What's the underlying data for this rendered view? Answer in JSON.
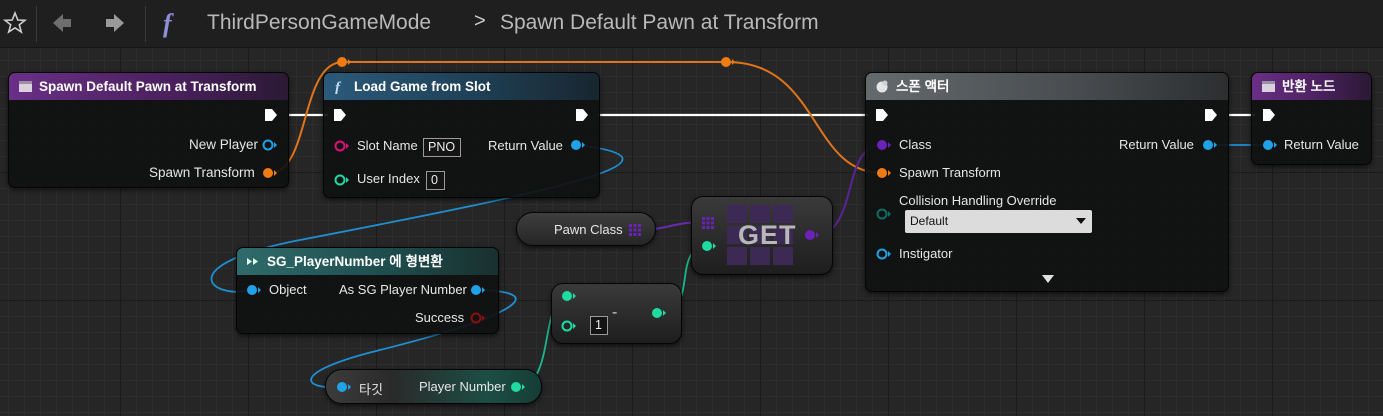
{
  "breadcrumb": {
    "blueprint": "ThirdPersonGameMode",
    "separator": ">",
    "graph": "Spawn Default Pawn at Transform"
  },
  "icons": {
    "favorite": "star-icon",
    "back": "back-arrow-icon",
    "forward": "forward-arrow-icon",
    "function": "function-icon"
  },
  "colors": {
    "exec": "#ffffff",
    "object_pin": "#1fa2e8",
    "transform_pin": "#f07b13",
    "class_pin": "#6b22b8",
    "string_pin": "#e0107b",
    "int_pin": "#1fdba0",
    "bool_pin": "#8c0f0f"
  },
  "nodes": {
    "entry": {
      "title": "Spawn Default Pawn at Transform",
      "pin_new_player": "New Player",
      "pin_spawn_transform": "Spawn Transform"
    },
    "load_game": {
      "title": "Load Game from Slot",
      "pin_slot_name": "Slot Name",
      "slot_name_value": "PNO",
      "pin_user_index": "User Index",
      "user_index_value": "0",
      "pin_return": "Return Value"
    },
    "cast": {
      "title": "SG_PlayerNumber 에 형변환",
      "pin_object": "Object",
      "pin_as": "As SG Player Number",
      "pin_success": "Success"
    },
    "pawn_class": {
      "label": "Pawn Class"
    },
    "get": {
      "label": "GET"
    },
    "subtract": {
      "input_value": "1",
      "operator": "-"
    },
    "target_get": {
      "pin_target": "타깃",
      "pin_player_number": "Player Number"
    },
    "spawn_actor": {
      "title": "스폰 액터",
      "pin_class": "Class",
      "pin_spawn_transform": "Spawn Transform",
      "pin_collision": "Collision Handling Override",
      "collision_value": "Default",
      "pin_instigator": "Instigator",
      "pin_return": "Return Value"
    },
    "return_node": {
      "title": "반환 노드",
      "pin_return": "Return Value"
    }
  }
}
